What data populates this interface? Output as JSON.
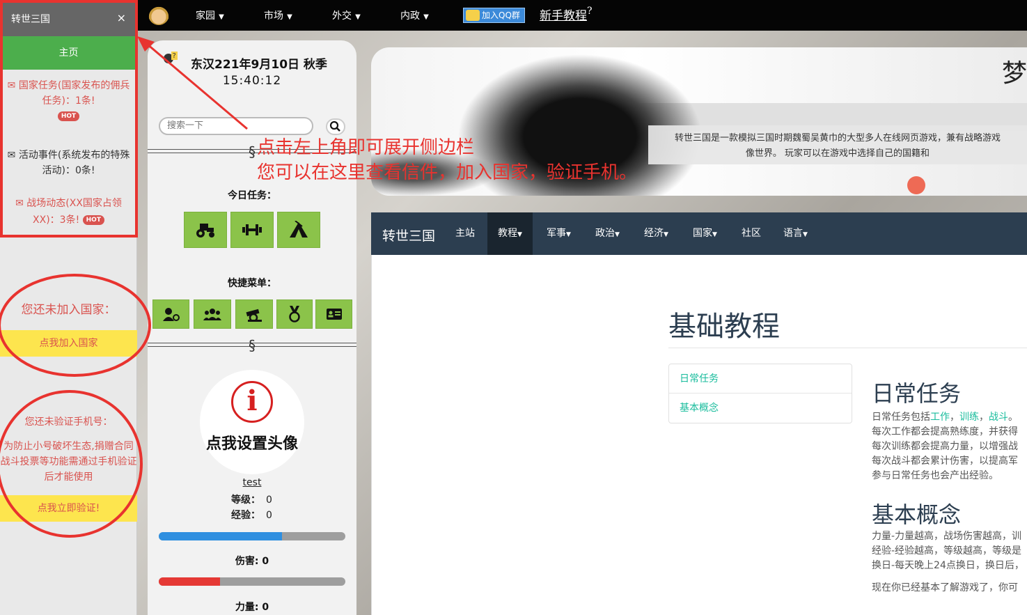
{
  "topnav": {
    "menus": [
      "家园",
      "市场",
      "外交",
      "内政"
    ],
    "qq_label": "加入QQ群",
    "tutorial": "新手教程",
    "tutorial_mark": "?"
  },
  "sidebar": {
    "title": "转世三国",
    "close": "×",
    "home": "主页",
    "msg1": "国家任务(国家发布的佣兵任务)：1条!",
    "msg2": "活动事件(系统发布的特殊活动)：0条!",
    "msg3": "战场动态(XX国家占领XX)：3条!",
    "hot": "HOT",
    "join_title": "您还未加入国家：",
    "join_btn": "点我加入国家",
    "phone_title": "您还未验证手机号：",
    "phone_desc": "为防止小号破坏生态,捐赠合同战斗投票等功能需通过手机验证后才能使用",
    "phone_btn": "点我立即验证!"
  },
  "panel": {
    "q_mark": "?",
    "date": "东汉221年9月10日 秋季",
    "time": "15:40:12",
    "search_placeholder": "搜索一下",
    "section": "§",
    "today_tasks": "今日任务：",
    "quick_menu": "快捷菜单：",
    "info_glyph": "i",
    "set_avatar": "点我设置头像",
    "username": "test",
    "level_label": "等级：",
    "level": "0",
    "exp_label": "经验：",
    "exp": "0",
    "damage_label": "伤害: 0",
    "power_label": "力量: 0",
    "exp_bar": 0.66,
    "damage_bar": 0.33
  },
  "banner": {
    "text1": "转世三国是一款模拟三国时期魏蜀吴黄巾的大型多人在线网页游戏，兼有战略游戏",
    "text2": "像世界。 玩家可以在游戏中选择自己的国籍和",
    "logo": "梦"
  },
  "cnav": {
    "brand": "转世三国",
    "items": [
      "主站",
      "教程",
      "军事",
      "政治",
      "经济",
      "国家",
      "社区",
      "语言"
    ]
  },
  "content": {
    "title": "基础教程",
    "toc": [
      "日常任务",
      "基本概念"
    ],
    "h_daily": "日常任务",
    "daily_p1_pre": "日常任务包括",
    "daily_link1": "工作",
    "daily_link2": "训练",
    "daily_link3": "战斗",
    "sep": "，",
    "end": "。",
    "daily_p2": "每次工作都会提高熟练度，并获得",
    "daily_p3": "每次训练都会提高力量，以增强战",
    "daily_p4": "每次战斗都会累计伤害，以提高军",
    "daily_p5": "参与日常任务也会产出经验。",
    "h_concept": "基本概念",
    "concept_p1": "力量-力量越高，战场伤害越高，训",
    "concept_p2": "经验-经验越高，等级越高，等级是",
    "concept_p3": "换日-每天晚上24点换日，换日后，",
    "concept_p4": "现在你已经基本了解游戏了，你可"
  },
  "annotation": {
    "line1": "点击左上角即可展开侧边栏",
    "line2": "您可以在这里查看信件，加入国家，验证手机。"
  }
}
